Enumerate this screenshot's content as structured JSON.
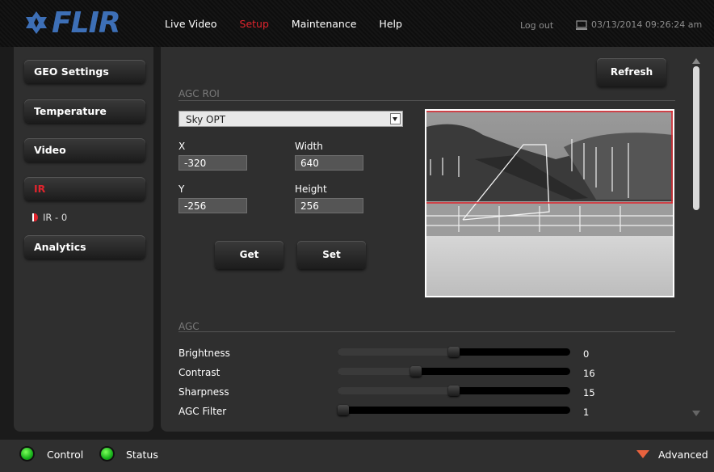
{
  "header": {
    "logo_text": "FLIR",
    "nav": [
      "Live Video",
      "Setup",
      "Maintenance",
      "Help"
    ],
    "active_nav": "Setup",
    "logout": "Log out",
    "datetime": "03/13/2014 09:26:24 am"
  },
  "sidebar": {
    "items": [
      "GEO Settings",
      "Temperature",
      "Video",
      "IR",
      "Analytics"
    ],
    "active": "IR",
    "subitem": "IR - 0"
  },
  "main": {
    "refresh_label": "Refresh",
    "roi": {
      "title": "AGC ROI",
      "preset": "Sky OPT",
      "x_label": "X",
      "x_value": "-320",
      "width_label": "Width",
      "width_value": "640",
      "y_label": "Y",
      "y_value": "-256",
      "height_label": "Height",
      "height_value": "256",
      "get_label": "Get",
      "set_label": "Set"
    },
    "agc": {
      "title": "AGC",
      "sliders": [
        {
          "label": "Brightness",
          "value": "0",
          "fraction": 0.5
        },
        {
          "label": "Contrast",
          "value": "16",
          "fraction": 0.33
        },
        {
          "label": "Sharpness",
          "value": "15",
          "fraction": 0.5
        },
        {
          "label": "AGC Filter",
          "value": "1",
          "fraction": 0.0
        }
      ]
    }
  },
  "footer": {
    "control": "Control",
    "status": "Status",
    "advanced": "Advanced"
  },
  "colors": {
    "accent_red": "#e0242d",
    "logo_blue": "#3d6fb6",
    "led_green": "#17b11a"
  }
}
